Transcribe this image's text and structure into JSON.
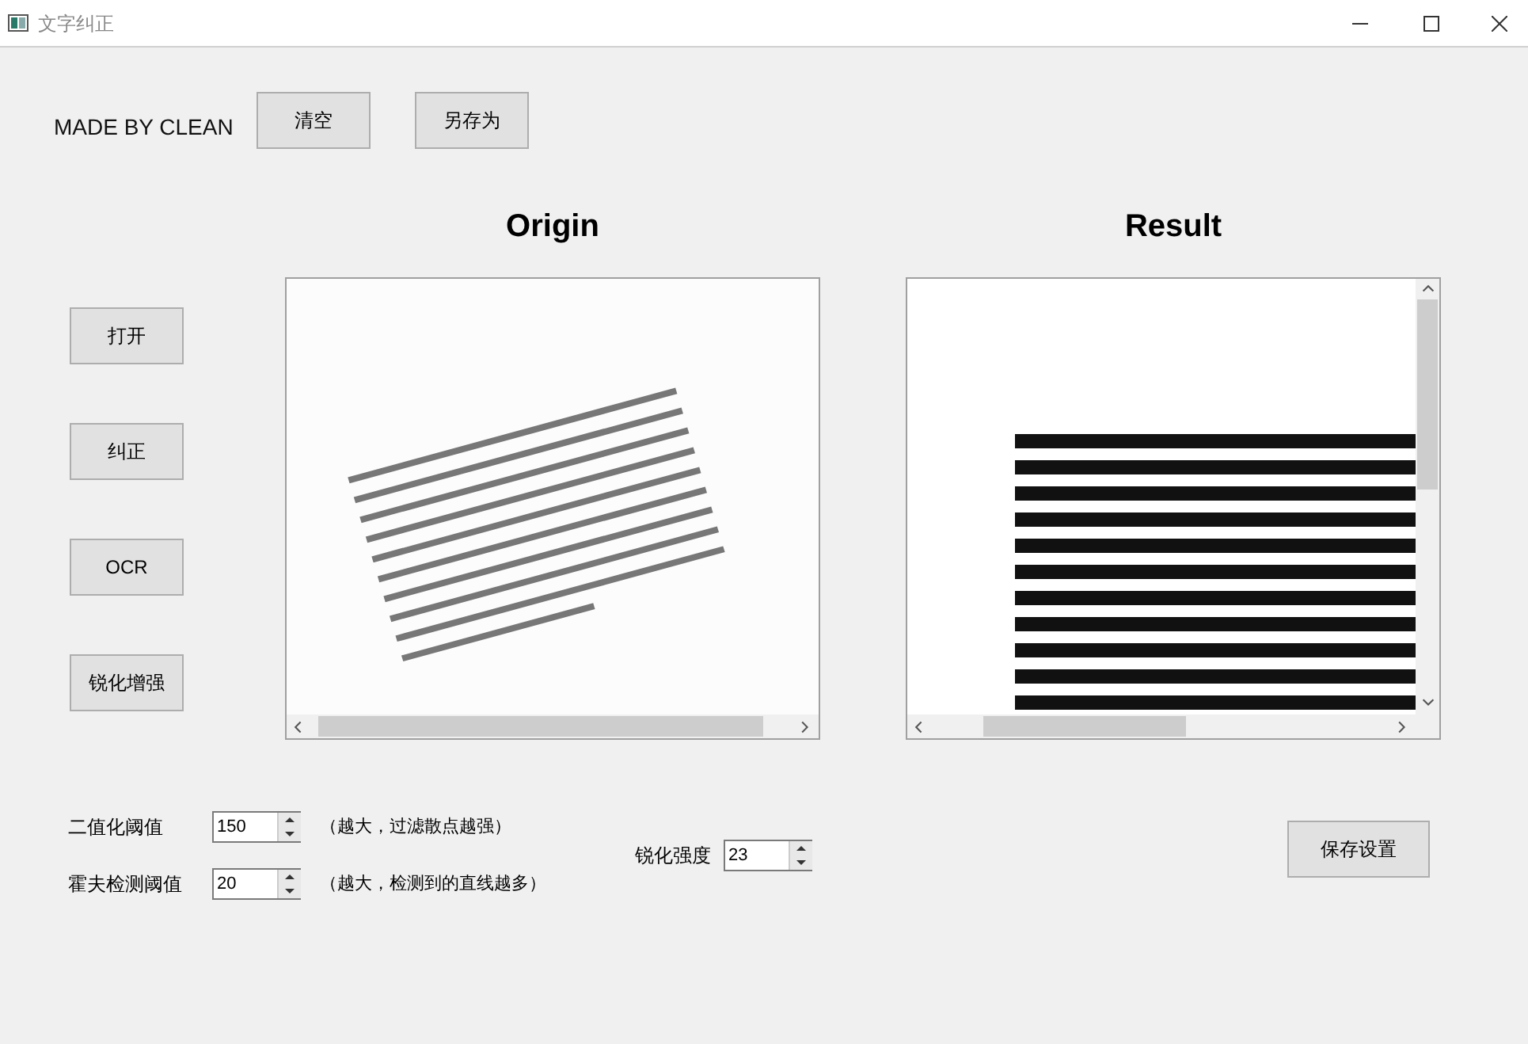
{
  "window": {
    "title": "文字纠正"
  },
  "header": {
    "credit": "MADE BY CLEAN",
    "buttons": [
      "清空",
      "另存为"
    ]
  },
  "panels": [
    {
      "title": "Origin",
      "kind": "picture",
      "vertical_scroll": false
    },
    {
      "title": "Result",
      "kind": "picture",
      "vertical_scroll": true
    }
  ],
  "side_buttons": [
    "打开",
    "纠正",
    "OCR",
    "锐化增强"
  ],
  "settings": [
    {
      "label": "二值化阈值",
      "value": "150",
      "hint": "（越大，过滤散点越强）"
    },
    {
      "label": "霍夫检测阈值",
      "value": "20",
      "hint": "（越大，检测到的直线越多）"
    }
  ],
  "sharpen": {
    "label": "锐化强度",
    "value": "23"
  },
  "save_button": "保存设置"
}
